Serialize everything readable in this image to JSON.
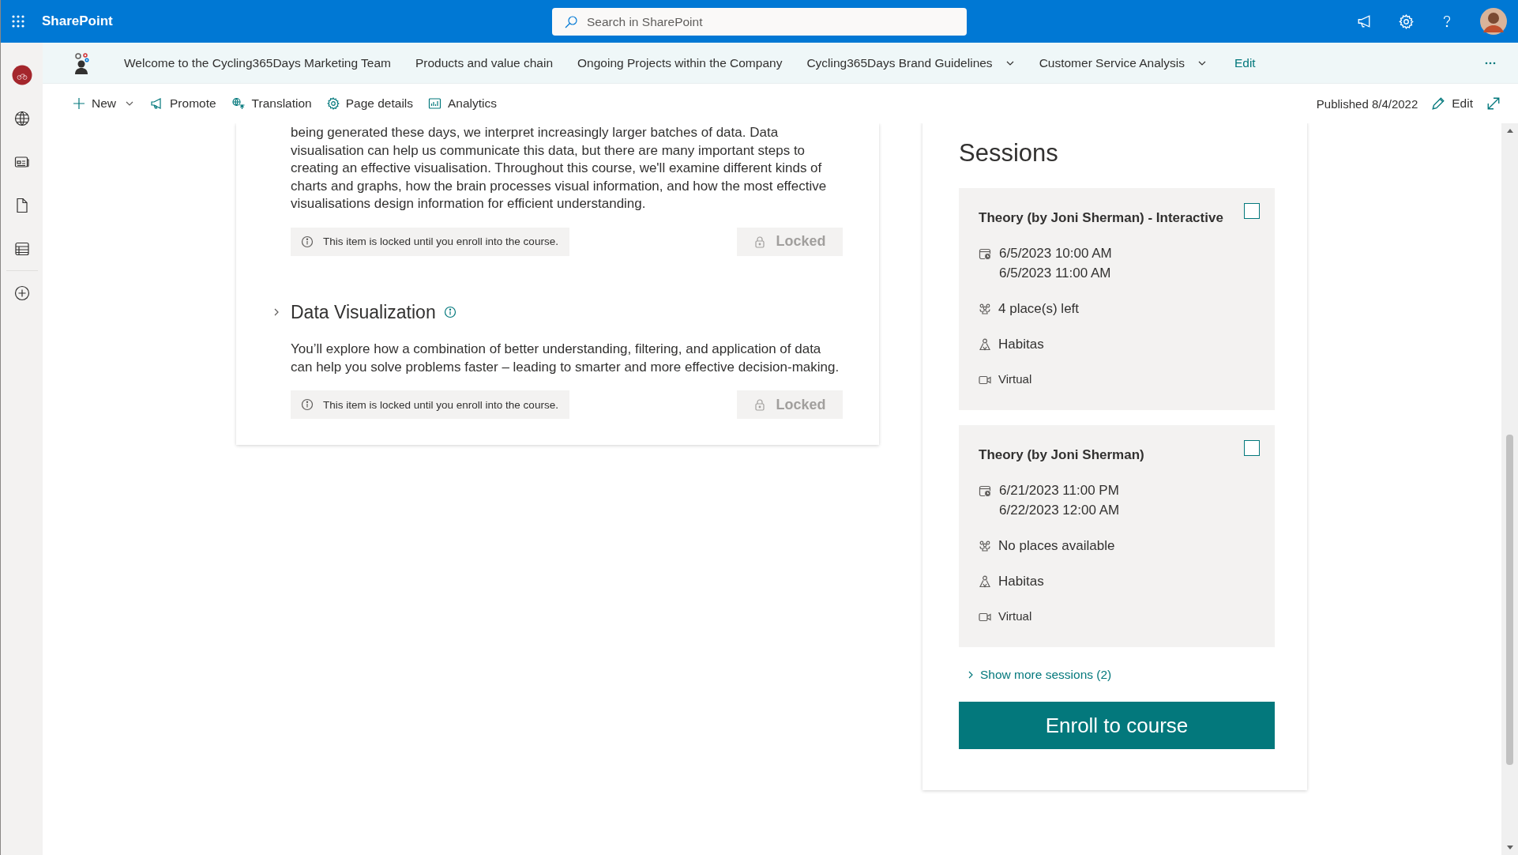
{
  "app": {
    "name": "SharePoint"
  },
  "search": {
    "placeholder": "Search in SharePoint"
  },
  "hub_nav": {
    "items": [
      {
        "label": "Welcome to the Cycling365Days Marketing Team",
        "dropdown": false
      },
      {
        "label": "Products and value chain",
        "dropdown": false
      },
      {
        "label": "Ongoing Projects within the Company",
        "dropdown": false
      },
      {
        "label": "Cycling365Days Brand Guidelines",
        "dropdown": true
      },
      {
        "label": "Customer Service Analysis",
        "dropdown": true
      }
    ],
    "edit": "Edit"
  },
  "command_bar": {
    "items": [
      {
        "label": "New",
        "kind": "new"
      },
      {
        "label": "Promote",
        "kind": "promote"
      },
      {
        "label": "Translation",
        "kind": "translation"
      },
      {
        "label": "Page details",
        "kind": "details"
      },
      {
        "label": "Analytics",
        "kind": "analytics"
      }
    ],
    "published": "Published 8/4/2022",
    "edit": "Edit"
  },
  "modules": [
    {
      "description": "being generated these days, we interpret increasingly larger batches of data. Data visualisation can help us communicate this data, but there are many important steps to creating an effective visualisation. Throughout this course, we'll examine different kinds of charts and graphs, how the brain processes visual information, and how the most effective visualisations design information for efficient understanding.",
      "lock_note": "This item is locked until you enroll into the course.",
      "button": "Locked",
      "disabled": true
    },
    {
      "title": "Data Visualization",
      "description": "You’ll explore how a combination of better understanding, filtering, and application of data can help you solve problems faster – leading to smarter and more effective decision-making.",
      "lock_note": "This item is locked until you enroll into the course.",
      "button": "Locked",
      "disabled": true
    }
  ],
  "sessions": {
    "title": "Sessions",
    "items": [
      {
        "title": "Theory (by Joni Sherman) - Interactive",
        "start": "6/5/2023 10:00 AM",
        "end": "6/5/2023 11:00 AM",
        "places": "4 place(s) left",
        "location": "Habitas",
        "mode": "Virtual",
        "checked": false
      },
      {
        "title": "Theory (by Joni Sherman)",
        "start": "6/21/2023 11:00 PM",
        "end": "6/22/2023 12:00 AM",
        "places": "No places available",
        "location": "Habitas",
        "mode": "Virtual",
        "checked": false
      }
    ],
    "show_more": "Show more sessions (2)",
    "enroll": "Enroll to course"
  }
}
